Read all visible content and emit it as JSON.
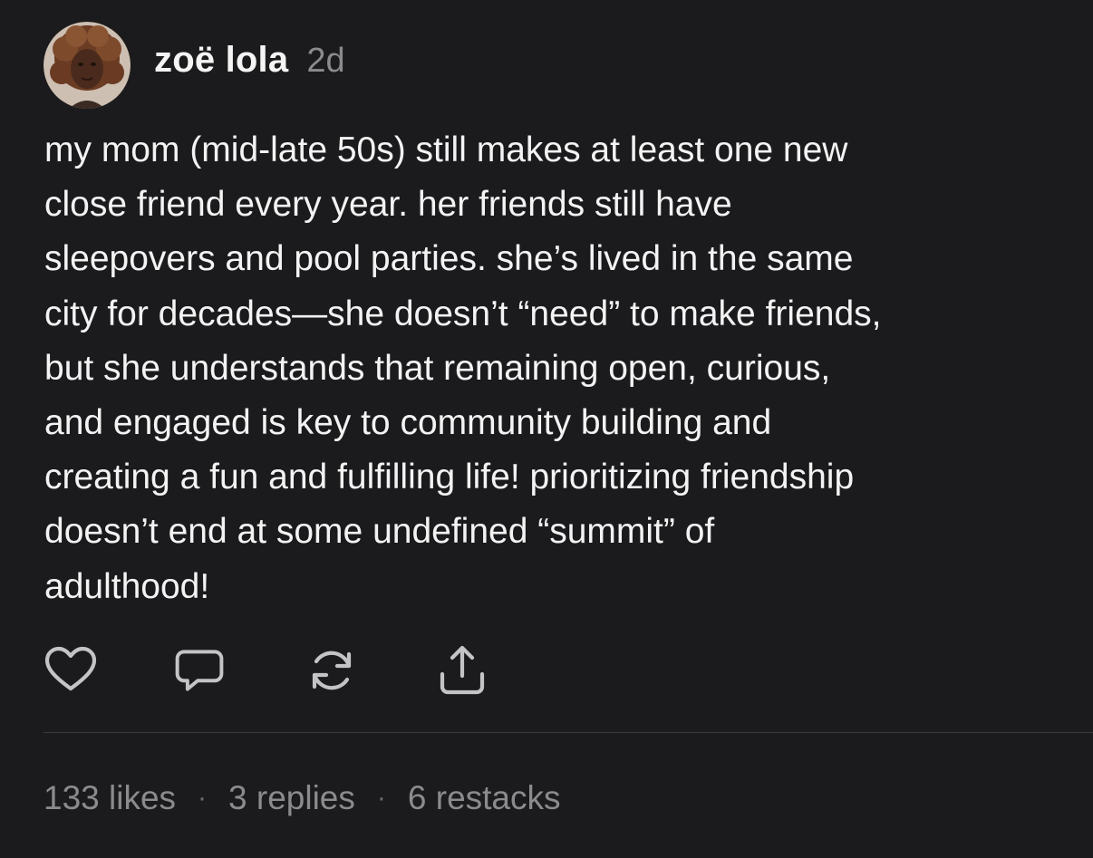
{
  "author": {
    "name": "zoë lola",
    "age": "2d"
  },
  "post": {
    "lines": [
      "my mom (mid-late 50s) still makes at least one new",
      "close friend every year. her friends still have",
      "sleepovers and pool parties. she’s lived in the same",
      "city for decades—she doesn’t “need” to make friends,",
      "but she understands that remaining open, curious,",
      "and engaged is key to community building and",
      "creating a fun and fulfilling life! prioritizing friendship",
      "doesn’t end at some undefined “summit” of",
      "adulthood!"
    ]
  },
  "actions": {
    "icons": [
      "heart-icon",
      "comment-icon",
      "restack-icon",
      "share-icon"
    ]
  },
  "stats": {
    "likes": "133 likes",
    "separator": "·",
    "replies": "3 replies",
    "restacks": "6 restacks"
  },
  "colors": {
    "background": "#1b1b1d",
    "text": "#f3f3f3",
    "muted": "#8b8b8e",
    "icon": "#c4c4c7",
    "divider": "#3a3a3d"
  }
}
